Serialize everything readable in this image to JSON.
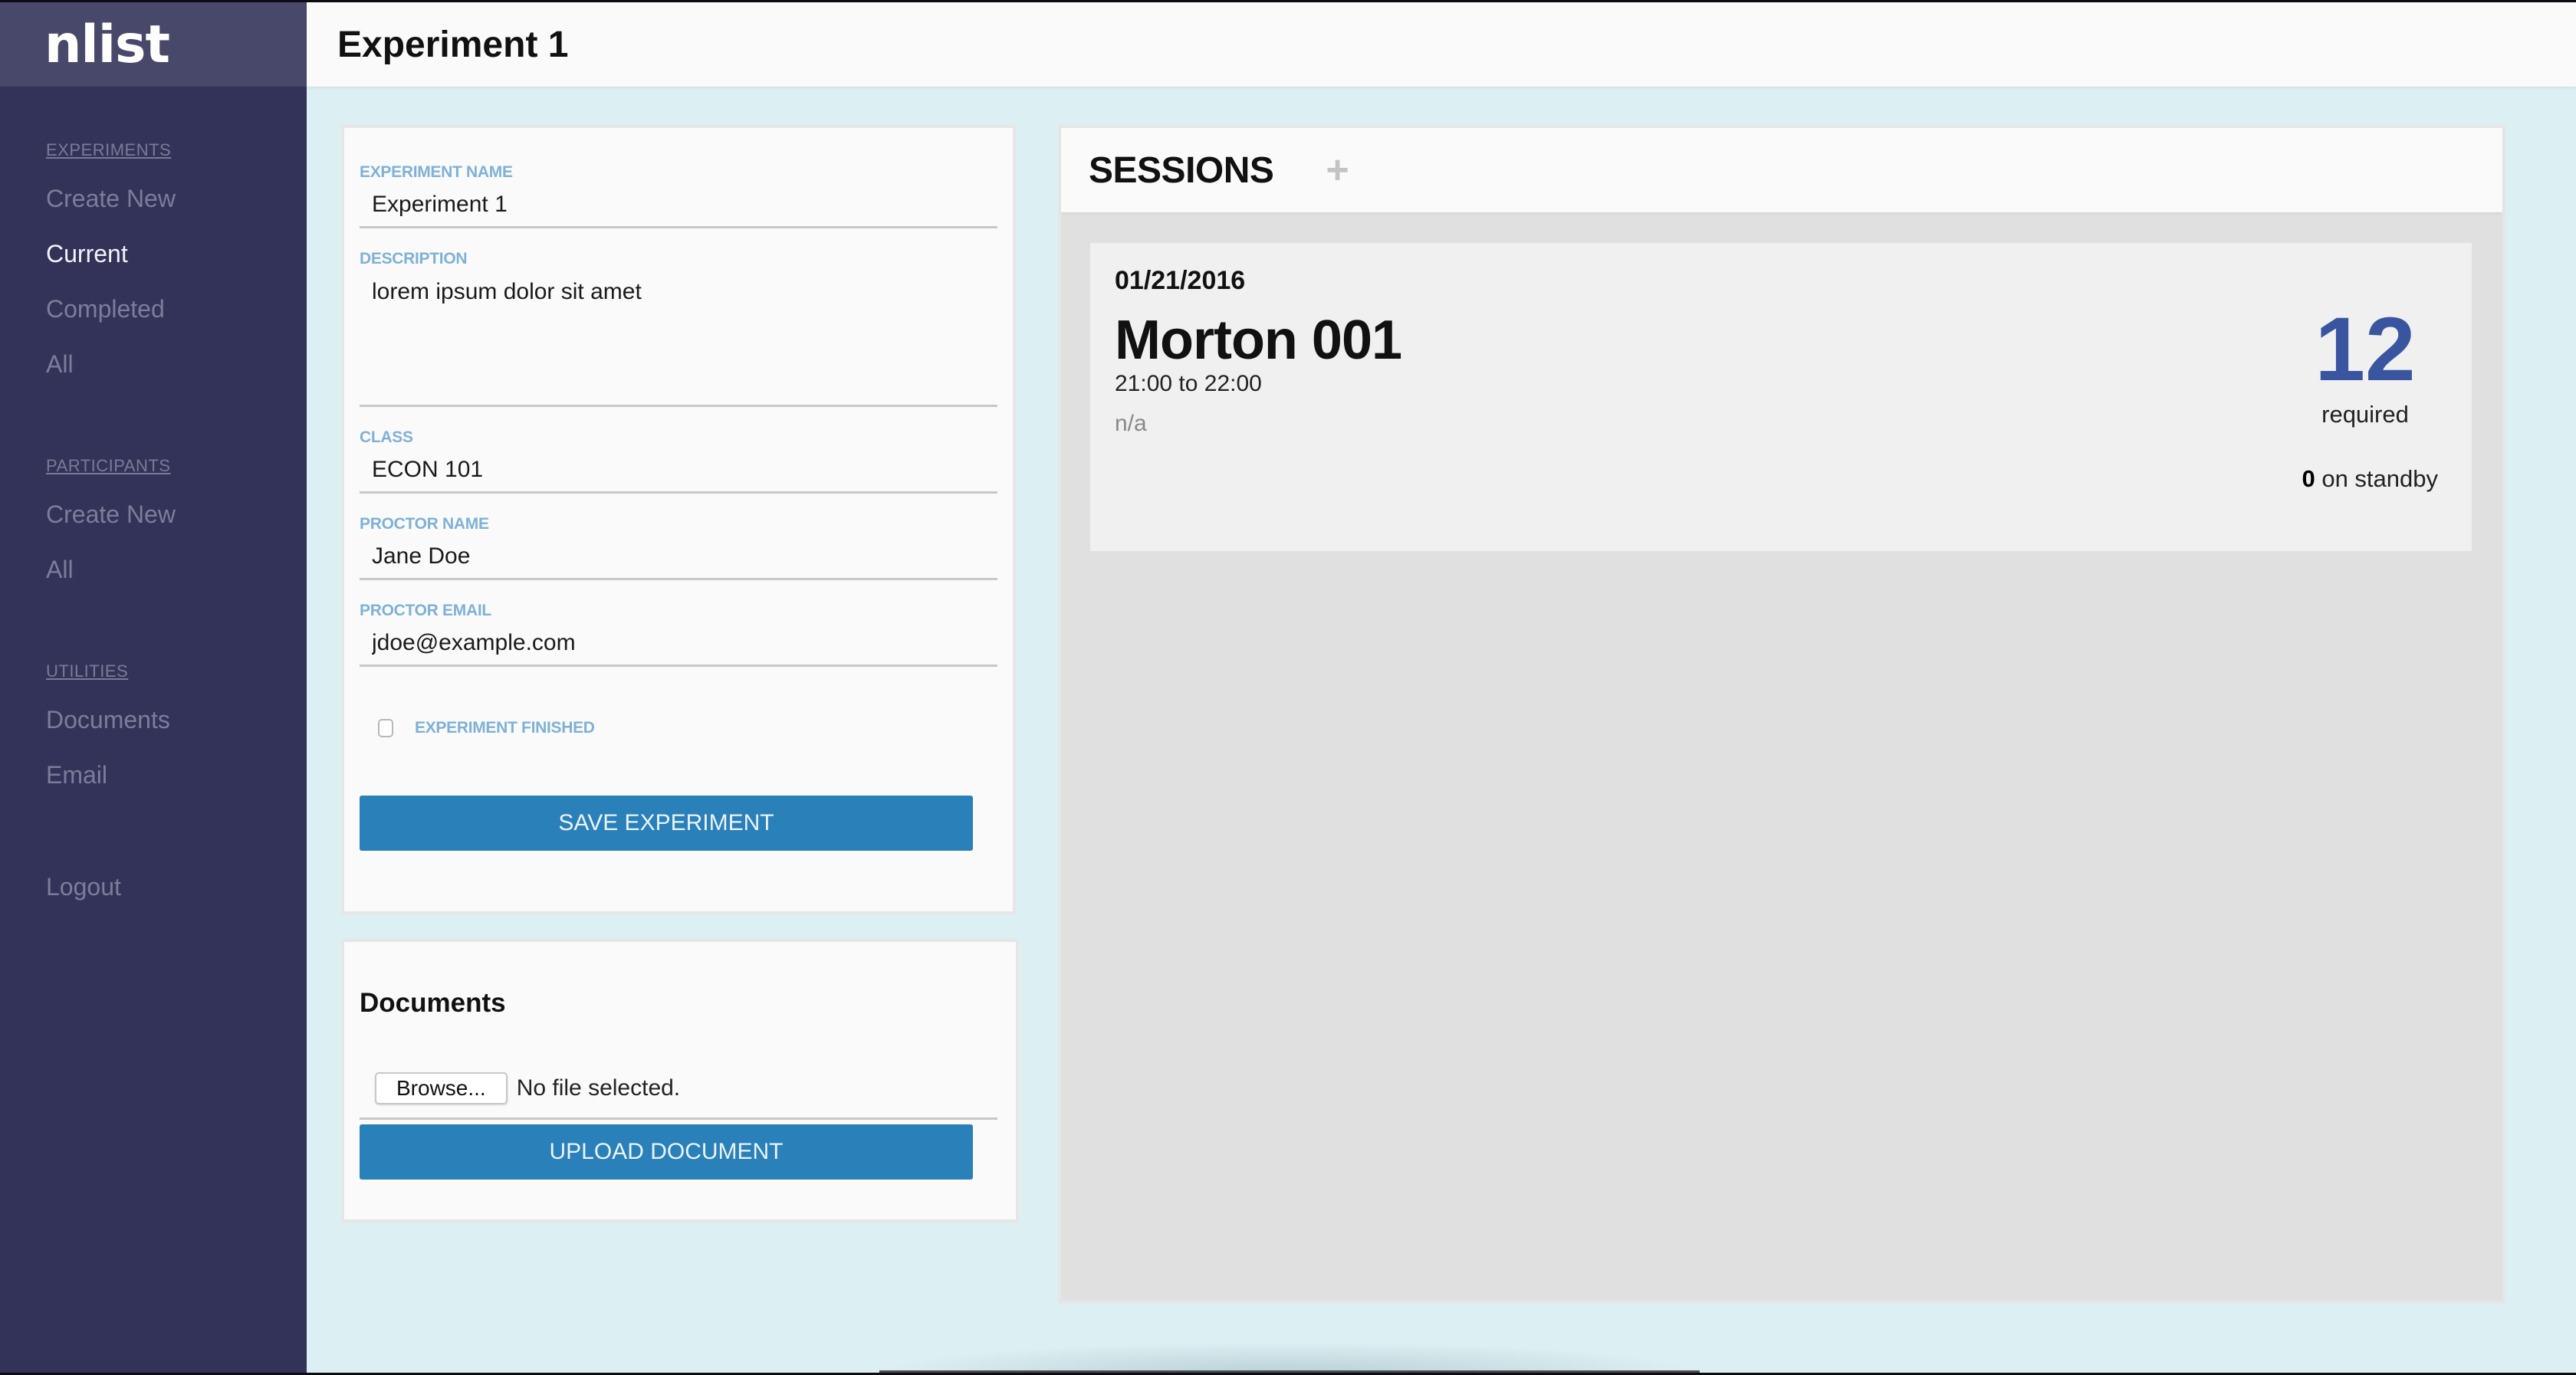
{
  "app": {
    "logo": "nlist",
    "page_title": "Experiment 1"
  },
  "sidebar": {
    "sections": [
      {
        "heading": "EXPERIMENTS",
        "items": [
          {
            "label": "Create New",
            "active": false
          },
          {
            "label": "Current",
            "active": true
          },
          {
            "label": "Completed",
            "active": false
          },
          {
            "label": "All",
            "active": false
          }
        ]
      },
      {
        "heading": "PARTICIPANTS",
        "items": [
          {
            "label": "Create New",
            "active": false
          },
          {
            "label": "All",
            "active": false
          }
        ]
      },
      {
        "heading": "UTILITIES",
        "items": [
          {
            "label": "Documents",
            "active": false
          },
          {
            "label": "Email",
            "active": false
          }
        ]
      }
    ],
    "logout": "Logout"
  },
  "experiment_form": {
    "fields": {
      "name": {
        "label": "EXPERIMENT NAME",
        "value": "Experiment 1"
      },
      "description": {
        "label": "DESCRIPTION",
        "value": "lorem ipsum dolor sit amet"
      },
      "class": {
        "label": "CLASS",
        "value": "ECON 101"
      },
      "proctor_name": {
        "label": "PROCTOR NAME",
        "value": "Jane Doe"
      },
      "proctor_email": {
        "label": "PROCTOR EMAIL",
        "value": "jdoe@example.com"
      }
    },
    "finished": {
      "label": "EXPERIMENT FINISHED",
      "checked": false
    },
    "save_label": "SAVE EXPERIMENT"
  },
  "documents": {
    "title": "Documents",
    "browse_label": "Browse...",
    "file_status": "No file selected.",
    "upload_label": "UPLOAD DOCUMENT"
  },
  "sessions": {
    "title": "SESSIONS",
    "add_icon": "plus-icon",
    "items": [
      {
        "date": "01/21/2016",
        "location": "Morton 001",
        "time": "21:00 to 22:00",
        "note": "n/a",
        "required_count": "12",
        "required_label": "required",
        "standby_count": "0",
        "standby_label": "on standby"
      }
    ]
  },
  "colors": {
    "sidebar_bg": "#33335a",
    "logo_bg": "#48486a",
    "main_bg": "#dceff2",
    "accent_button": "#2a80b9",
    "label_blue": "#7fb1d6",
    "required_count": "#3a559f"
  }
}
